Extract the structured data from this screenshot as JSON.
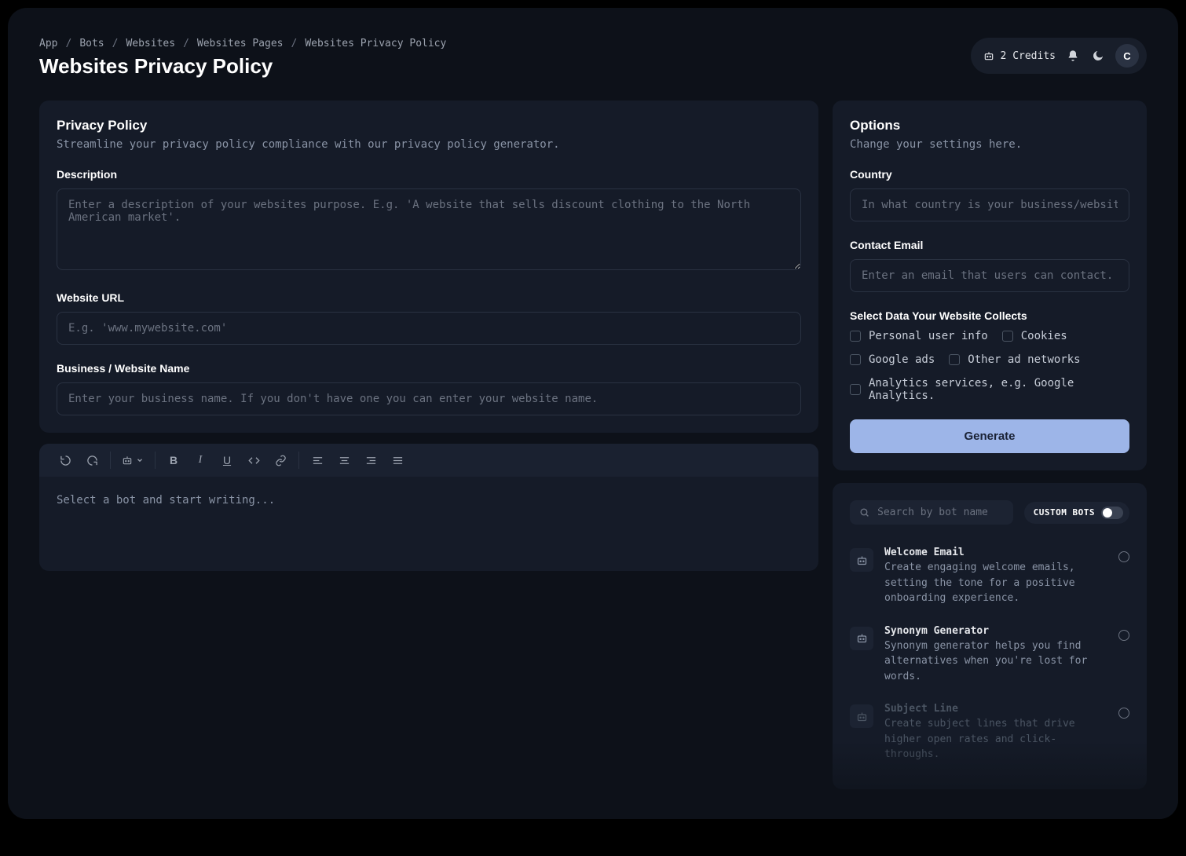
{
  "breadcrumb": [
    "App",
    "Bots",
    "Websites",
    "Websites Pages",
    "Websites Privacy Policy"
  ],
  "page_title": "Websites Privacy Policy",
  "header": {
    "credits_label": "2 Credits",
    "avatar_letter": "C"
  },
  "form": {
    "title": "Privacy Policy",
    "subtitle": "Streamline your privacy policy compliance with our privacy policy generator.",
    "description_label": "Description",
    "description_placeholder": "Enter a description of your websites purpose. E.g. 'A website that sells discount clothing to the North American market'.",
    "url_label": "Website URL",
    "url_placeholder": "E.g. 'www.mywebsite.com'",
    "name_label": "Business / Website Name",
    "name_placeholder": "Enter your business name. If you don't have one you can enter your website name."
  },
  "editor": {
    "placeholder": "Select a bot and start writing..."
  },
  "options": {
    "title": "Options",
    "subtitle": "Change your settings here.",
    "country_label": "Country",
    "country_placeholder": "In what country is your business/website located?",
    "email_label": "Contact Email",
    "email_placeholder": "Enter an email that users can contact. E.g. 'info@mysite.com'",
    "data_label": "Select Data Your Website Collects",
    "checkboxes": [
      "Personal user info",
      "Cookies",
      "Google ads",
      "Other ad networks",
      "Analytics services, e.g. Google Analytics."
    ],
    "generate_label": "Generate"
  },
  "bots": {
    "search_placeholder": "Search by bot name",
    "custom_label": "CUSTOM BOTS",
    "items": [
      {
        "name": "Welcome Email",
        "desc": "Create engaging welcome emails, setting the tone for a positive onboarding experience."
      },
      {
        "name": "Synonym Generator",
        "desc": "Synonym generator helps you find alternatives when you're lost for words."
      },
      {
        "name": "Subject Line",
        "desc": "Create subject lines that drive higher open rates and click-throughs."
      }
    ]
  }
}
